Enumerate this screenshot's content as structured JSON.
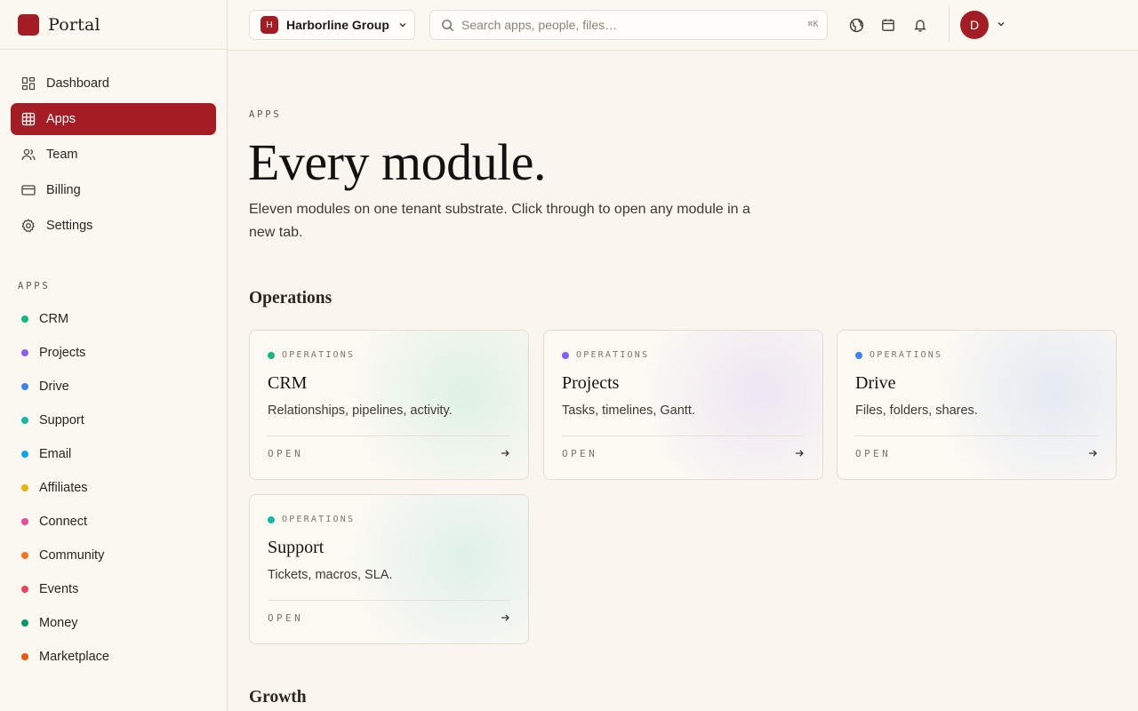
{
  "brand": {
    "name": "Portal"
  },
  "nav": [
    {
      "label": "Dashboard",
      "icon": "dashboard-icon",
      "active": false
    },
    {
      "label": "Apps",
      "icon": "grid-icon",
      "active": true
    },
    {
      "label": "Team",
      "icon": "users-icon",
      "active": false
    },
    {
      "label": "Billing",
      "icon": "credit-card-icon",
      "active": false
    },
    {
      "label": "Settings",
      "icon": "gear-icon",
      "active": false
    }
  ],
  "apps_section": {
    "label": "APPS",
    "items": [
      {
        "label": "CRM",
        "color": "#10b981"
      },
      {
        "label": "Projects",
        "color": "#8b5cf6"
      },
      {
        "label": "Drive",
        "color": "#3b82f6"
      },
      {
        "label": "Support",
        "color": "#14b8a6"
      },
      {
        "label": "Email",
        "color": "#0ea5e9"
      },
      {
        "label": "Affiliates",
        "color": "#eab308"
      },
      {
        "label": "Connect",
        "color": "#ec4899"
      },
      {
        "label": "Community",
        "color": "#f97316"
      },
      {
        "label": "Events",
        "color": "#f43f5e"
      },
      {
        "label": "Money",
        "color": "#059669"
      },
      {
        "label": "Marketplace",
        "color": "#ea580c"
      }
    ]
  },
  "topbar": {
    "org": {
      "badge": "H",
      "name": "Harborline Group"
    },
    "search": {
      "placeholder": "Search apps, people, files…",
      "shortcut": "⌘K"
    },
    "avatar_initial": "D"
  },
  "main": {
    "eyebrow": "APPS",
    "title": "Every module.",
    "description": "Eleven modules on one tenant substrate. Click through to open any module in a new tab.",
    "groups": [
      {
        "title": "Operations",
        "cards": [
          {
            "tag": "OPERATIONS",
            "title": "CRM",
            "description": "Relationships, pipelines, activity.",
            "open_label": "OPEN",
            "color": "#10b981"
          },
          {
            "tag": "OPERATIONS",
            "title": "Projects",
            "description": "Tasks, timelines, Gantt.",
            "open_label": "OPEN",
            "color": "#8b5cf6"
          },
          {
            "tag": "OPERATIONS",
            "title": "Drive",
            "description": "Files, folders, shares.",
            "open_label": "OPEN",
            "color": "#3b82f6"
          },
          {
            "tag": "OPERATIONS",
            "title": "Support",
            "description": "Tickets, macros, SLA.",
            "open_label": "OPEN",
            "color": "#14b8a6"
          }
        ]
      },
      {
        "title": "Growth",
        "cards": []
      }
    ]
  },
  "colors": {
    "accent": "#a51d24",
    "background": "#faf6ef"
  }
}
